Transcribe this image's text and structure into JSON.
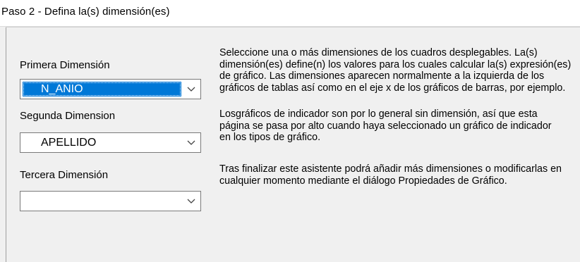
{
  "window": {
    "title": "Paso 2 - Defina la(s) dimensión(es)"
  },
  "form": {
    "primera": {
      "label": "Primera Dimensión",
      "value": "N_ANIO"
    },
    "segunda": {
      "label": "Segunda Dimension",
      "value": "APELLIDO"
    },
    "tercera": {
      "label": "Tercera Dimensión",
      "value": ""
    }
  },
  "help": {
    "p1": [
      "Seleccione una o más dimensiones de los cuadros desplegables. La(s)",
      "dimensión(es) define(n) los valores para los cuales calcular la(s) expresión(es)",
      "de gráfico. Las dimensiones aparecen normalmente a la izquierda de los",
      "gráficos de tablas así como en el eje x de los gráficos de barras, por ejemplo."
    ],
    "p2": [
      "Losgráficos de indicador son por lo general sin dimensión, así que esta",
      "página se pasa por alto cuando haya seleccionado un gráfico de indicador",
      "en los tipos de gráfico."
    ],
    "p3": [
      "Tras finalizar este asistente podrá añadir más dimensiones o modificarlas en",
      "cualquier momento mediante el diálogo Propiedades de Gráfico."
    ]
  },
  "icons": {
    "dropdown": "chevron-down-icon"
  },
  "colors": {
    "selection": "#0078d7",
    "panel": "#f0f0f0"
  }
}
